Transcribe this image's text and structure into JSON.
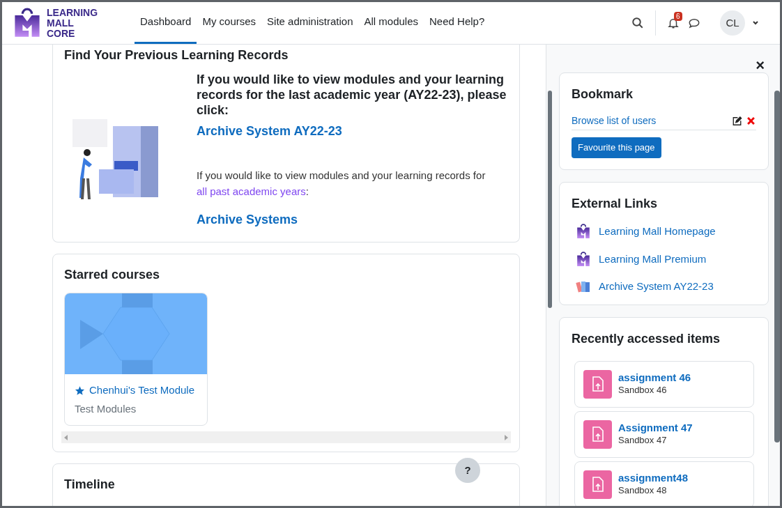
{
  "header": {
    "logo_text": [
      "LEARNING",
      "MALL",
      "CORE"
    ],
    "nav": [
      {
        "label": "Dashboard",
        "selected": true
      },
      {
        "label": "My courses",
        "selected": false
      },
      {
        "label": "Site administration",
        "selected": false
      },
      {
        "label": "All modules",
        "selected": false
      },
      {
        "label": "Need Help?",
        "selected": false
      }
    ],
    "notification_count": "6",
    "avatar_initials": "CL"
  },
  "records_card": {
    "title": "Find Your Previous Learning Records",
    "lead": "If you would like to view modules and your learning records for the last academic year (AY22-23), please click:",
    "link_1": "Archive System AY22-23",
    "text_before": "If you would like to view modules and your learning records for",
    "text_link": "all past academic years",
    "text_after": ":",
    "link_2": "Archive Systems"
  },
  "starred": {
    "title": "Starred courses",
    "courses": [
      {
        "name": "Chenhui's Test Module",
        "category": "Test Modules",
        "starred": true
      }
    ]
  },
  "timeline": {
    "title": "Timeline"
  },
  "help_button": "?",
  "drawer": {
    "close": "×",
    "bookmark": {
      "title": "Bookmark",
      "items": [
        "Browse list of users"
      ],
      "button": "Favourite this page"
    },
    "external_links": {
      "title": "External Links",
      "items": [
        {
          "label": "Learning Mall Homepage",
          "kind": "logo"
        },
        {
          "label": "Learning Mall Premium",
          "kind": "logo"
        },
        {
          "label": "Archive System AY22-23",
          "kind": "books"
        }
      ]
    },
    "recent": {
      "title": "Recently accessed items",
      "items": [
        {
          "name": "assignment 46",
          "course": "Sandbox 46"
        },
        {
          "name": "Assignment 47",
          "course": "Sandbox 47"
        },
        {
          "name": "assignment48",
          "course": "Sandbox 48"
        }
      ]
    }
  }
}
